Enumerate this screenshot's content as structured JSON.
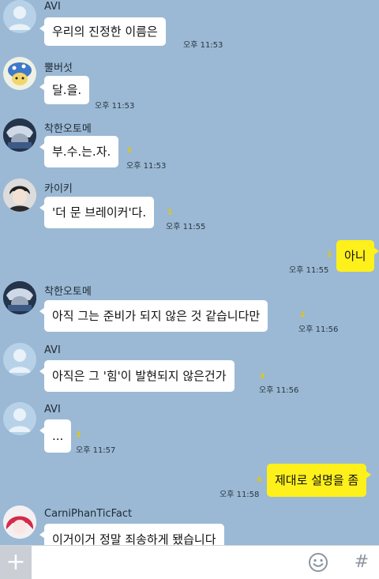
{
  "messages": [
    {
      "sender": "AVI",
      "text": "우리의 진정한 이름은",
      "time": "오후 11:53",
      "unread": ""
    },
    {
      "sender": "뿔버섯",
      "text": "달.을.",
      "time": "오후 11:53",
      "unread": ""
    },
    {
      "sender": "착한오토메",
      "text": "부.수.는.자.",
      "time": "오후 11:53",
      "unread": "1"
    },
    {
      "sender": "카이키",
      "text": "'더 문 브레이커'다.",
      "time": "오후 11:55",
      "unread": "1"
    },
    {
      "sender": "",
      "text": "아니",
      "time": "오후 11:55",
      "unread": "2"
    },
    {
      "sender": "착한오토메",
      "text": "아직 그는 준비가 되지 않은 것 같습니다만",
      "time": "오후 11:56",
      "unread": "2"
    },
    {
      "sender": "AVI",
      "text": "아직은 그 '힘'이 발현되지 않은건가",
      "time": "오후 11:56",
      "unread": "3"
    },
    {
      "sender": "AVI",
      "text": "...",
      "time": "오후 11:57",
      "unread": "3"
    },
    {
      "sender": "",
      "text": "제대로 설명을 좀",
      "time": "오후 11:58",
      "unread": "4"
    },
    {
      "sender": "CarniPhanTicFact",
      "text": "이거이거 정말 죄송하게 됐습니다",
      "time": "",
      "unread": ""
    }
  ],
  "composer": {
    "plus_label": "+",
    "placeholder": "",
    "hash_label": "#"
  },
  "colors": {
    "background": "#9bb9d4",
    "my_bubble": "#fef01b",
    "other_bubble": "#ffffff",
    "unread": "#e6c800"
  }
}
